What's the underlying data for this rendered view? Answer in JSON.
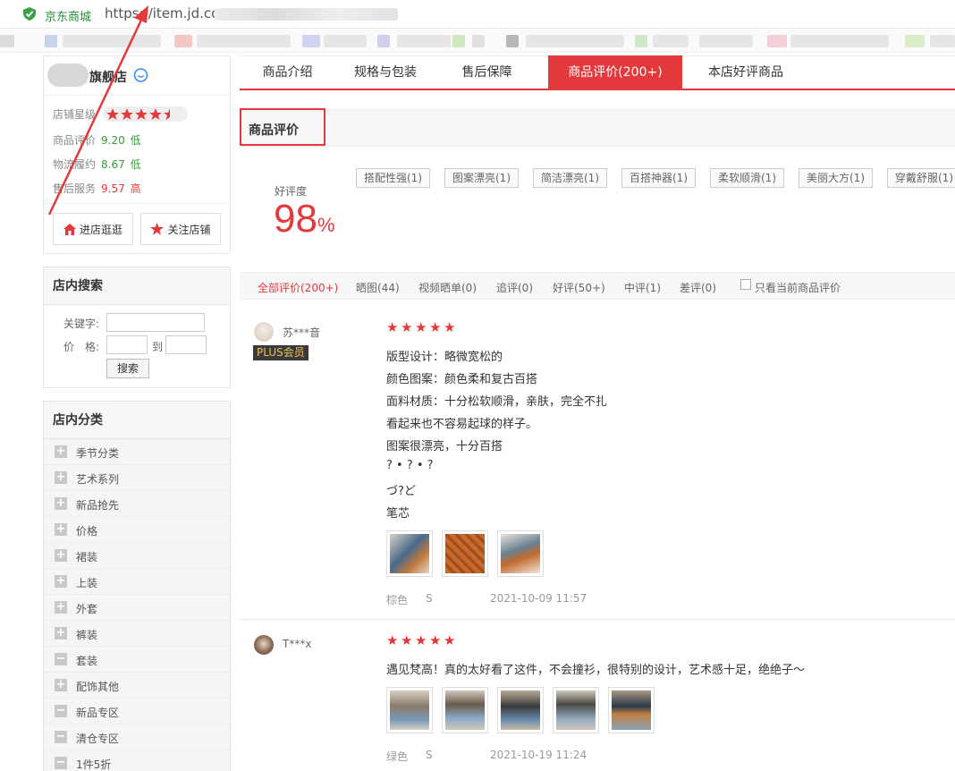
{
  "browser": {
    "site_name": "京东商城",
    "url": "https://item.jd.com"
  },
  "shop": {
    "name": "旗舰店",
    "stars_label": "店铺星级",
    "scores": [
      {
        "label": "商品评价",
        "value": "9.20",
        "level": "低"
      },
      {
        "label": "物流履约",
        "value": "8.67",
        "level": "低"
      },
      {
        "label": "售后服务",
        "value": "9.57",
        "level": "高"
      }
    ],
    "enter_label": "进店逛逛",
    "follow_label": "关注店铺"
  },
  "search": {
    "title": "店内搜索",
    "keyword_label": "关键字:",
    "price_label": "价　格:",
    "to_label": "到",
    "button": "搜索"
  },
  "categories": {
    "title": "店内分类",
    "items": [
      {
        "label": "季节分类",
        "sign": "+"
      },
      {
        "label": "艺术系列",
        "sign": "+"
      },
      {
        "label": "新品抢先",
        "sign": "+"
      },
      {
        "label": "价格",
        "sign": "+"
      },
      {
        "label": "裙装",
        "sign": "+"
      },
      {
        "label": "上装",
        "sign": "+"
      },
      {
        "label": "外套",
        "sign": "+"
      },
      {
        "label": "裤装",
        "sign": "+"
      },
      {
        "label": "套装",
        "sign": "−"
      },
      {
        "label": "配饰其他",
        "sign": "+"
      },
      {
        "label": "新品专区",
        "sign": "−"
      },
      {
        "label": "清仓专区",
        "sign": "−"
      },
      {
        "label": "1件5折",
        "sign": "−"
      }
    ]
  },
  "tabs": [
    "商品介绍",
    "规格与包装",
    "售后保障",
    "商品评价(200+)",
    "本店好评商品"
  ],
  "section_title": "商品评价",
  "rating": {
    "label": "好评度",
    "value": "98",
    "unit": "%"
  },
  "tags": [
    "搭配性强(1)",
    "图案漂亮(1)",
    "简洁漂亮(1)",
    "百搭神器(1)",
    "柔软顺滑(1)",
    "美丽大方(1)",
    "穿戴舒服(1)"
  ],
  "filters": [
    "全部评价(200+)",
    "晒图(44)",
    "视频晒单(0)",
    "追评(0)",
    "好评(50+)",
    "中评(1)",
    "差评(0)"
  ],
  "only_current_label": "只看当前商品评价",
  "reviews": [
    {
      "user": "苏***音",
      "badge": "PLUS会员",
      "stars": 5,
      "lines": [
        "版型设计：略微宽松的",
        "颜色图案：颜色柔和复古百搭",
        "面料材质：十分松软顺滑，亲肤，完全不扎",
        "看起来也不容易起球的样子。",
        "图案很漂亮，十分百搭",
        "? • ? • ?",
        "づ?ど",
        "笔芯"
      ],
      "color": "棕色",
      "size": "S",
      "date": "2021-10-09 11:57"
    },
    {
      "user": "T***x",
      "stars": 5,
      "lines": [
        "遇见梵高！真的太好看了这件，不会撞衫，很特别的设计，艺术感十足，绝绝子～"
      ],
      "color": "绿色",
      "size": "S",
      "date": "2021-10-19 11:24"
    }
  ],
  "colors": {
    "accent": "#e4393c",
    "good": "#3a9a3a"
  }
}
